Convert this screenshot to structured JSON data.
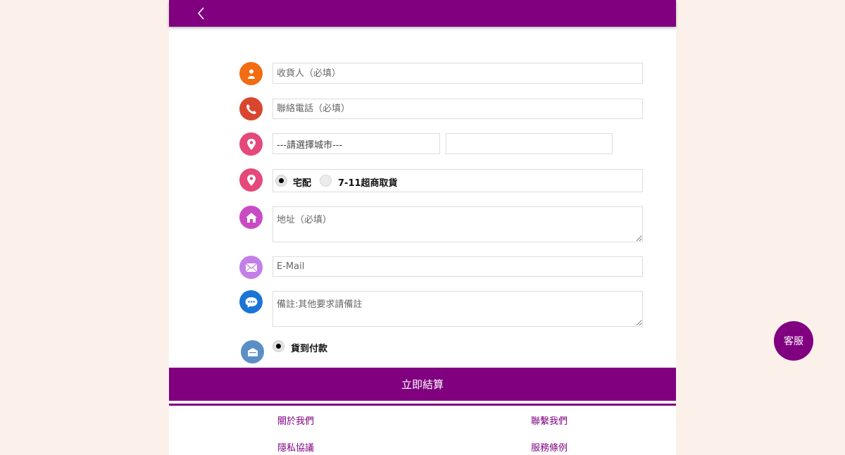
{
  "colors": {
    "brand": "#800080",
    "background": "#fcf0eb",
    "icon_person": "#f26c12",
    "icon_phone": "#d9462f",
    "icon_location": "#e5487a",
    "icon_home": "#c94bc4",
    "icon_mail": "#c47ee8",
    "icon_chat": "#1b74d6",
    "icon_payment": "#5b8ec4"
  },
  "header": {
    "back_icon": "chevron-left-icon"
  },
  "form": {
    "recipient": {
      "placeholder": "收貨人（必填）",
      "icon": "person-icon"
    },
    "phone": {
      "placeholder": "聯絡電話（必填）",
      "icon": "phone-icon"
    },
    "city": {
      "selected": "---請選擇城市---",
      "district_selected": "",
      "icon": "location-icon"
    },
    "delivery": {
      "icon": "location-icon",
      "options": [
        {
          "label": "宅配",
          "checked": true
        },
        {
          "label": "7-11超商取貨",
          "checked": false
        }
      ]
    },
    "address": {
      "placeholder": "地址（必填）",
      "icon": "home-icon"
    },
    "email": {
      "placeholder": "E-Mail",
      "icon": "mail-icon"
    },
    "note": {
      "placeholder": "備註:其他要求請備註",
      "icon": "chat-icon"
    },
    "payment": {
      "icon": "payment-icon",
      "options": [
        {
          "label": "貨到付款",
          "checked": true
        }
      ]
    }
  },
  "checkout_label": "立即結算",
  "footer": {
    "links": [
      "關於我們",
      "聯繫我們",
      "隱私協議",
      "服務條例"
    ]
  },
  "customer_service_label": "客服"
}
